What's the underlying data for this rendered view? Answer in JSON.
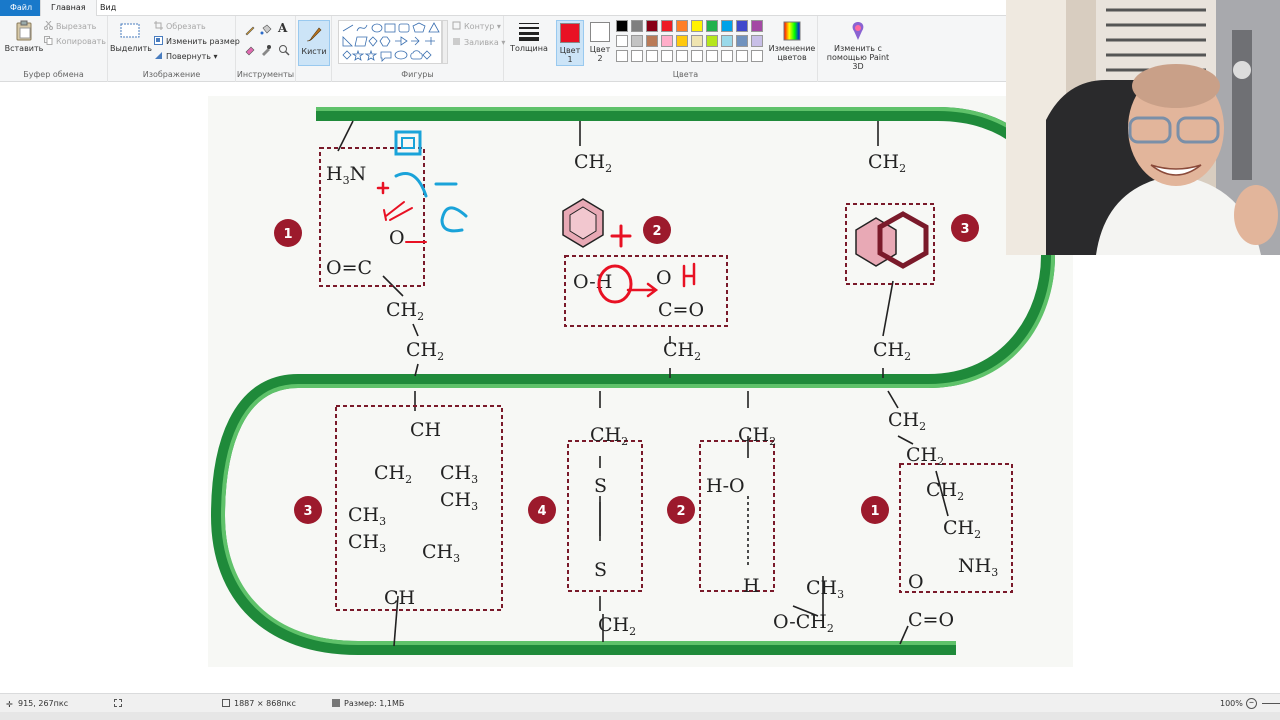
{
  "menu": {
    "file": "Файл",
    "home": "Главная",
    "view": "Вид"
  },
  "ribbon": {
    "clipboard": {
      "label": "Буфер обмена",
      "paste": "Вставить",
      "cut": "Вырезать",
      "copy": "Копировать"
    },
    "image": {
      "label": "Изображение",
      "select": "Выделить",
      "crop": "Обрезать",
      "resize": "Изменить размер",
      "rotate": "Повернуть"
    },
    "tools": {
      "label": "Инструменты"
    },
    "brushes": {
      "label": "Кисти"
    },
    "shapes": {
      "label": "Фигуры",
      "outline": "Контур",
      "fill": "Заливка"
    },
    "size": {
      "label": "Толщина"
    },
    "colors": {
      "label": "Цвета",
      "color1_label": "Цвет",
      "color1_num": "1",
      "color2_label": "Цвет",
      "color2_num": "2",
      "color1_value": "#e81123",
      "color2_value": "#ffffff",
      "palette_row1": [
        "#000000",
        "#7f7f7f",
        "#880015",
        "#ed1c24",
        "#ff7f27",
        "#fff200",
        "#22b14c",
        "#00a2e8",
        "#3f48cc",
        "#a349a4"
      ],
      "palette_row2": [
        "#ffffff",
        "#c3c3c3",
        "#b97a57",
        "#ffaec9",
        "#ffc90e",
        "#efe4b0",
        "#b5e61d",
        "#99d9ea",
        "#7092be",
        "#c8bfe7"
      ],
      "edit_label_1": "Изменение",
      "edit_label_2": "цветов"
    },
    "paint3d": {
      "line1": "Изменить с",
      "line2": "помощью Paint 3D"
    }
  },
  "diagram": {
    "badges": [
      "1",
      "2",
      "3",
      "3",
      "4",
      "2",
      "1"
    ],
    "groups": {
      "ch2": "CH",
      "sub2": "2",
      "sub3": "3",
      "ch": "CH",
      "h3n": "H",
      "h3n_n": "N",
      "nh": "NH",
      "o": "O",
      "o_eq_c": "O=C",
      "c_eq_o": "C=O",
      "s": "S",
      "h": "H",
      "ho": "H-O",
      "oh": "O-H",
      "och": "O-CH"
    },
    "annotations": {
      "e_mark": "e",
      "plus": "+",
      "minus": "−",
      "h_mark": "H",
      "o_mark": "O"
    }
  },
  "status": {
    "cursor": "915, 267пкс",
    "dimensions": "1887 × 868пкс",
    "size": "Размер: 1,1МБ",
    "zoom": "100%"
  }
}
